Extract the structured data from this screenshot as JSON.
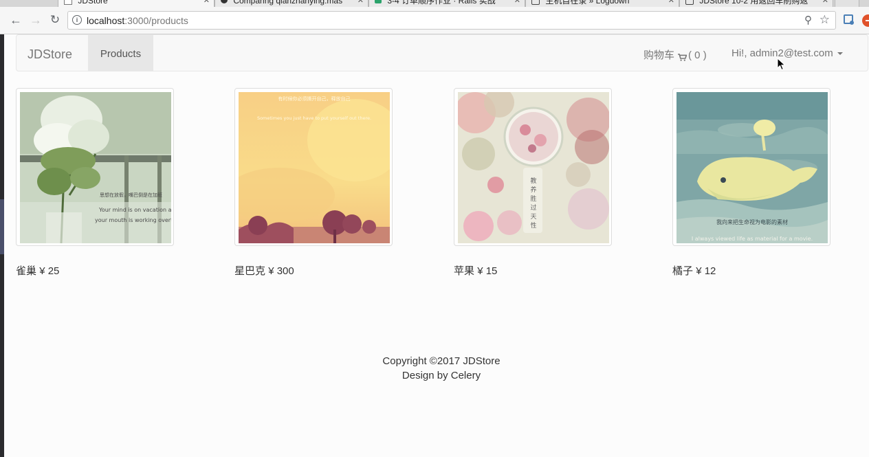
{
  "browser": {
    "tabs": [
      {
        "title": "JDStore"
      },
      {
        "title": "Comparing qianzhanying:mas"
      },
      {
        "title": "3-4 订单顺序作业 · Rails 实战"
      },
      {
        "title": "生机自在录 » Logdown"
      },
      {
        "title": "JDStore 10-2 用返回车削购返"
      }
    ],
    "url_host": "localhost",
    "url_path": ":3000/products"
  },
  "navbar": {
    "brand": "JDStore",
    "products_link": "Products",
    "cart_label": "购物车",
    "cart_count": "( 0 )",
    "user_greeting": "Hi!, admin2@test.com"
  },
  "products": [
    {
      "name": "雀巢",
      "price": "¥ 25",
      "image_text": [
        "思想在放假，嘴巴倒是在加班",
        "Your mind is on vacation and",
        "your mouth is working overtime."
      ]
    },
    {
      "name": "星巴克",
      "price": "¥ 300",
      "image_text": [
        "有时候你必须撕开自己，释放自己",
        "Sometimes you just have to put yourself out there."
      ]
    },
    {
      "name": "苹果",
      "price": "¥ 15",
      "image_text": [
        "教",
        "养",
        "胜",
        "过",
        "天",
        "性"
      ]
    },
    {
      "name": "橘子",
      "price": "¥ 12",
      "image_text": [
        "我向来把生命视为电影的素材",
        "I always viewed life as material for a movie."
      ]
    }
  ],
  "footer": {
    "copyright": "Copyright ©2017 JDStore",
    "credit": "Design by Celery"
  },
  "colors": {
    "navbar_bg": "#f8f8f8",
    "active_nav_bg": "#e7e7e7",
    "link_gray": "#777777"
  }
}
